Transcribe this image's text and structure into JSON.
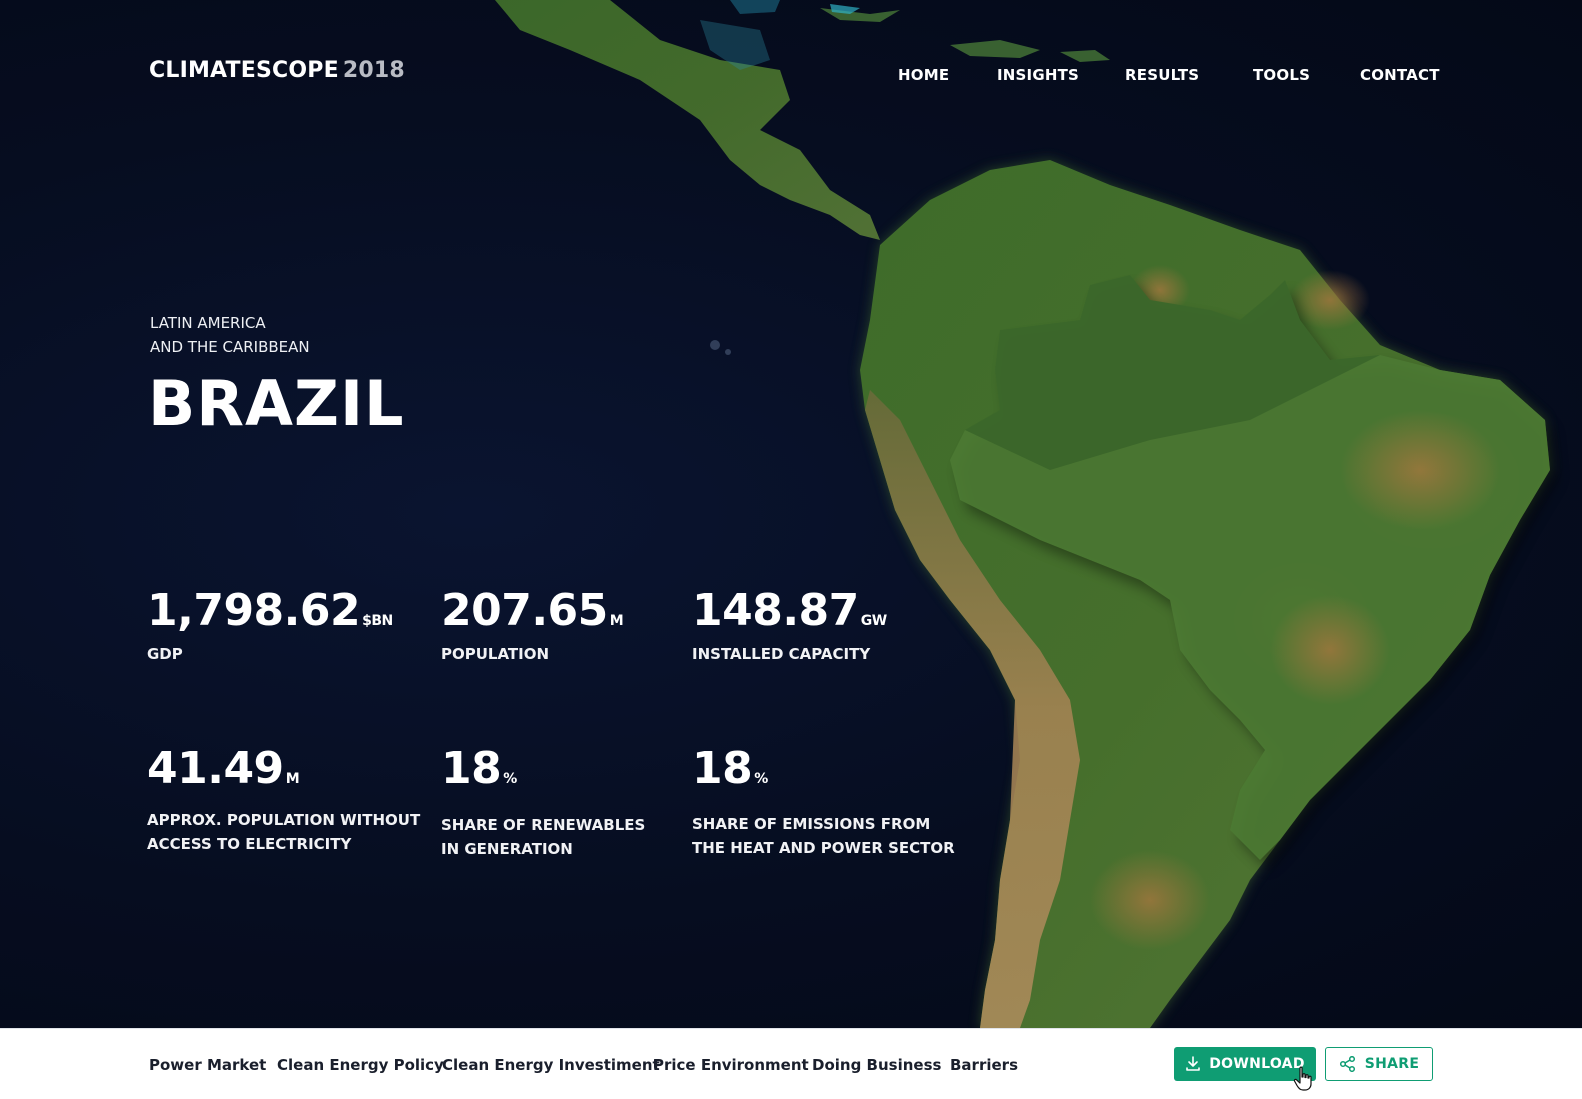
{
  "header": {
    "logo_name": "CLIMATESCOPE",
    "logo_year": "2018",
    "nav": [
      "HOME",
      "INSIGHTS",
      "RESULTS",
      "TOOLS",
      "CONTACT"
    ]
  },
  "hero": {
    "region_line1": "LATIN AMERICA",
    "region_line2": "AND THE CARIBBEAN",
    "country": "BRAZIL"
  },
  "stats": [
    {
      "value": "1,798.62",
      "unit": "$BN",
      "label1": "GDP",
      "label2": ""
    },
    {
      "value": "207.65",
      "unit": "M",
      "label1": "POPULATION",
      "label2": ""
    },
    {
      "value": "148.87",
      "unit": "GW",
      "label1": "INSTALLED CAPACITY",
      "label2": ""
    },
    {
      "value": "41.49",
      "unit": "M",
      "label1": "APPROX. POPULATION WITHOUT",
      "label2": "ACCESS TO ELECTRICITY"
    },
    {
      "value": "18",
      "unit": "%",
      "label1": "SHARE OF RENEWABLES",
      "label2": "IN GENERATION"
    },
    {
      "value": "18",
      "unit": "%",
      "label1": "SHARE OF EMISSIONS FROM",
      "label2": "THE HEAT AND POWER SECTOR"
    }
  ],
  "bottom_bar": {
    "tabs": [
      "Power Market",
      "Clean Energy Policy",
      "Clean Energy Investiment",
      "Price Environment",
      "Doing Business",
      "Barriers"
    ],
    "download_label": "DOWNLOAD",
    "share_label": "SHARE"
  },
  "colors": {
    "accent": "#0f9d73",
    "background": "#050b1a",
    "land_green": "#3d6b2a",
    "land_brown": "#9c7848"
  },
  "icons": {
    "download": "download-icon",
    "share": "share-icon",
    "cursor": "hand-pointer-icon"
  }
}
